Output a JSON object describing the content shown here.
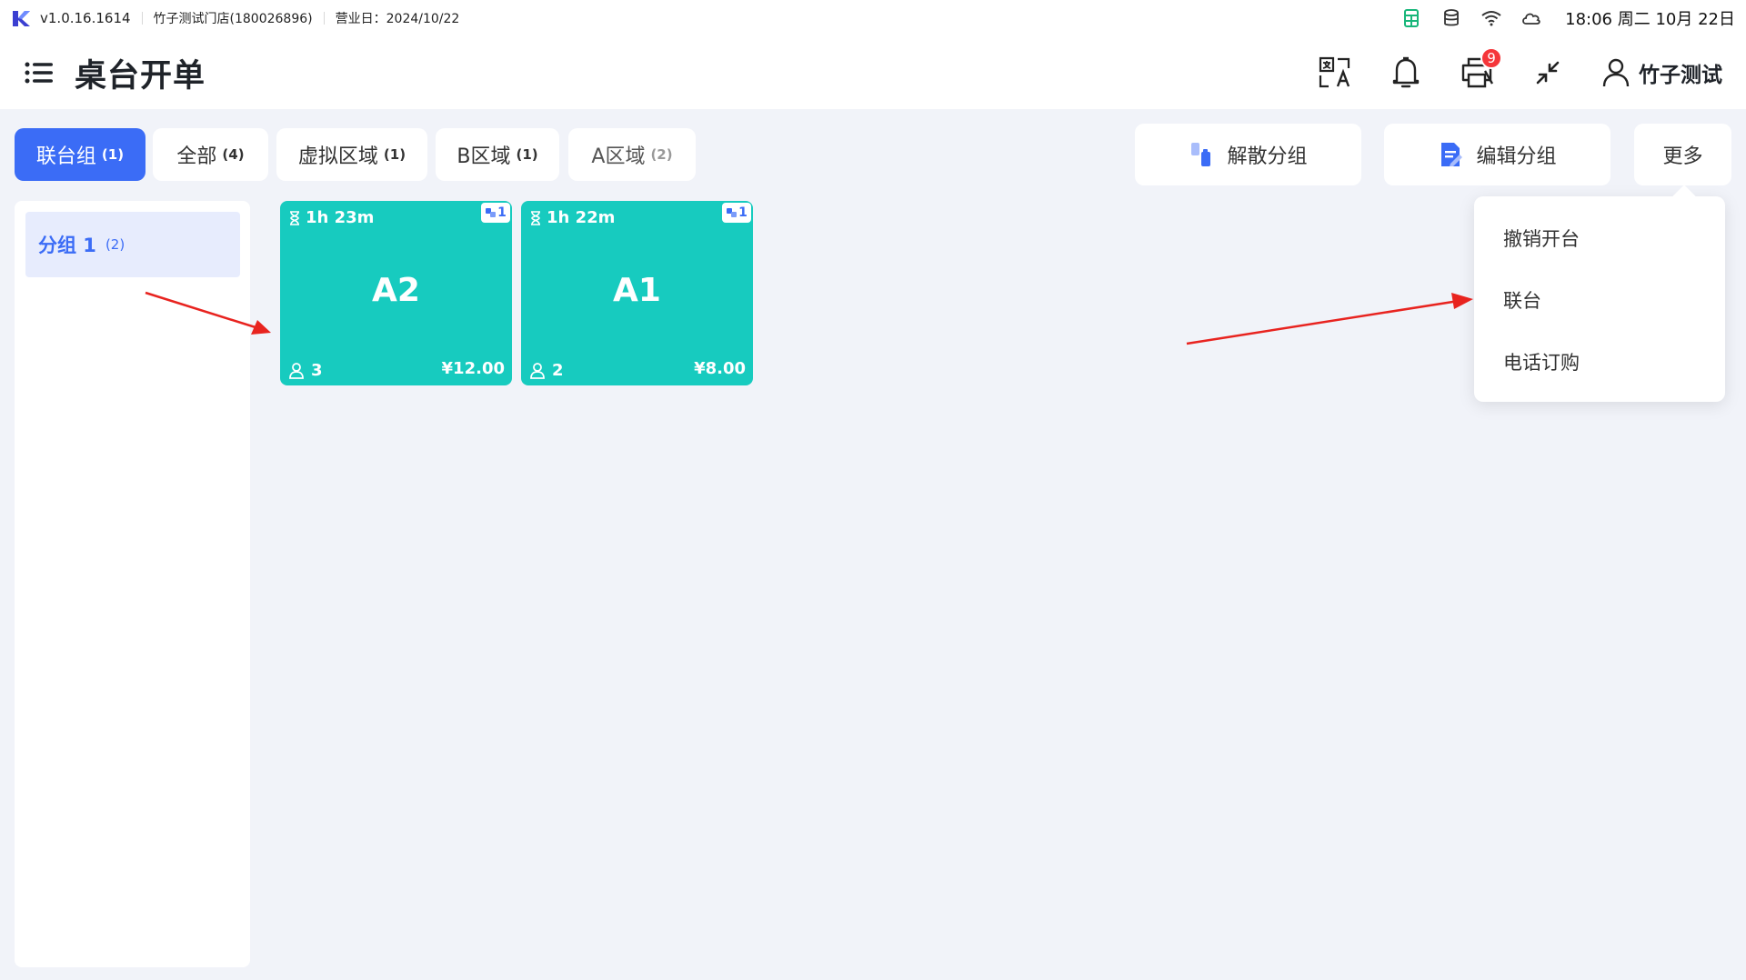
{
  "statusbar": {
    "version": "v1.0.16.1614",
    "store": "竹子测试门店(180026896)",
    "business_day": "营业日：2024/10/22",
    "clock": "18:06 周二 10月 22日",
    "icons": [
      "sheet-icon",
      "database-icon",
      "wifi-icon",
      "cloud-icon"
    ]
  },
  "header": {
    "title": "桌台开单",
    "printer_badge": "9",
    "user_name": "竹子测试"
  },
  "tabs": [
    {
      "label": "联台组",
      "count": "(1)",
      "active": true
    },
    {
      "label": "全部",
      "count": "(4)"
    },
    {
      "label": "虚拟区域",
      "count": "(1)"
    },
    {
      "label": "B区域",
      "count": "(1)"
    },
    {
      "label": "A区域",
      "count": "(2)"
    }
  ],
  "actions": {
    "dissolve": "解散分组",
    "edit": "编辑分组",
    "more": "更多"
  },
  "groups": [
    {
      "name": "分组 1",
      "count": "(2)"
    }
  ],
  "tables": [
    {
      "timer": "1h 23m",
      "tag": "1",
      "name": "A2",
      "guests": "3",
      "price": "¥12.00"
    },
    {
      "timer": "1h 22m",
      "tag": "1",
      "name": "A1",
      "guests": "2",
      "price": "¥8.00"
    }
  ],
  "more_menu": {
    "items": [
      "撤销开台",
      "联台",
      "电话订购"
    ]
  },
  "colors": {
    "accent": "#3b6cf6",
    "card": "#17cbbf",
    "badge": "#f5363a",
    "arrow": "#e8231f"
  }
}
